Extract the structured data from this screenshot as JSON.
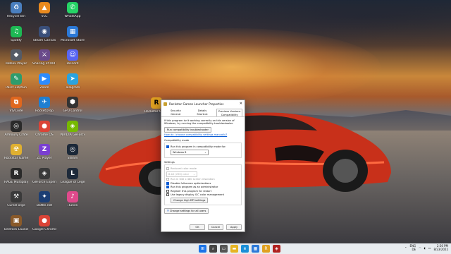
{
  "desktop_icons": [
    {
      "label": "Recycle Bin",
      "glyph": "♻",
      "color": "#4a7fbf"
    },
    {
      "label": "VLC",
      "glyph": "▲",
      "color": "#e98a1e"
    },
    {
      "label": "WhatsApp",
      "glyph": "✆",
      "color": "#25d366"
    },
    {
      "label": "Spotify",
      "glyph": "♫",
      "color": "#1db954"
    },
    {
      "label": "Steam Canvas",
      "glyph": "◉",
      "color": "#3a4f7a"
    },
    {
      "label": "Microsoft Store",
      "glyph": "▦",
      "color": "#2b79d8"
    },
    {
      "label": "Roblox Player",
      "glyph": "◆",
      "color": "#555b66"
    },
    {
      "label": "Sharing of Old Classic",
      "glyph": "⚔",
      "color": "#6a4a8a"
    },
    {
      "label": "Discord",
      "glyph": "☺",
      "color": "#5865f2"
    },
    {
      "label": "Paint 3D/Pain",
      "glyph": "✎",
      "color": "#2d9c6c"
    },
    {
      "label": "Zoom",
      "glyph": "▶",
      "color": "#2d8cff"
    },
    {
      "label": "Telegram",
      "glyph": "➤",
      "color": "#2aa3df"
    },
    {
      "label": "VS/Code",
      "glyph": "⧉",
      "color": "#e0671e"
    },
    {
      "label": "RocketDrop",
      "glyph": "✈",
      "color": "#1f7fd1"
    },
    {
      "label": "GPU Control",
      "glyph": "⬢",
      "color": "#333"
    },
    {
      "label": "Armoury Crate",
      "glyph": "◎",
      "color": "#2a2a2a"
    },
    {
      "label": "Chrome OS",
      "glyph": "●",
      "color": "#db4437"
    },
    {
      "label": "NVIDIA GeForce",
      "glyph": "◈",
      "color": "#76b900"
    },
    {
      "label": "Rockstar Games",
      "glyph": "☢",
      "color": "#e0b030"
    },
    {
      "label": "Z1 Player",
      "glyph": "Z",
      "color": "#7a3fd1"
    },
    {
      "label": "Steam",
      "glyph": "◎",
      "color": "#1b2838"
    },
    {
      "label": "RAGE Multiplayer",
      "glyph": "R",
      "color": "#2a2a2a"
    },
    {
      "label": "GeForce Experience",
      "glyph": "◈",
      "color": "#3a3a3a"
    },
    {
      "label": "League of Legends",
      "glyph": "L",
      "color": "#1e2a3a"
    },
    {
      "label": "CurseForge",
      "glyph": "⚒",
      "color": "#3a3a3a"
    },
    {
      "label": "Battle.net",
      "glyph": "✦",
      "color": "#1c3e74"
    },
    {
      "label": "iTunes",
      "glyph": "♪",
      "color": "#e04a8c"
    },
    {
      "label": "Bedrock Launch",
      "glyph": "▣",
      "color": "#8a5a2a"
    },
    {
      "label": "Google Chrome",
      "glyph": "●",
      "color": "#db4437"
    }
  ],
  "shortcut_on_desktop": {
    "label": "Rockstar Games Launcher",
    "glyph": "R"
  },
  "dialog": {
    "title": "Rockstar Games Launcher Properties",
    "tabs": [
      "Security",
      "Details",
      "Previous Versions",
      "General",
      "Shortcut",
      "Compatibility"
    ],
    "intro": "If this program isn't working correctly on this version of Windows, try running the compatibility troubleshooter.",
    "troubleshooter_btn": "Run compatibility troubleshooter",
    "manual_link": "How do I choose compatibility settings manually?",
    "compat_mode_label": "Compatibility mode",
    "compat_mode_check": "Run this program in compatibility mode for:",
    "compat_mode_value": "Windows 8",
    "settings_label": "Settings",
    "reduced_color": "Reduced color mode",
    "color_value": "8-bit (256) color",
    "run_640": "Run in 640 x 480 screen resolution",
    "disable_fullscreen": "Disable fullscreen optimizations",
    "run_admin": "Run this program as an administrator",
    "register_restart": "Register this program for restart",
    "legacy_icc": "Use legacy display ICC color management",
    "high_dpi_btn": "Change high DPI settings",
    "all_users_btn": "Change settings for all users",
    "ok": "OK",
    "cancel": "Cancel",
    "apply": "Apply"
  },
  "taskbar": {
    "apps": [
      {
        "name": "windows-start",
        "glyph": "⊞",
        "color": "#1a73e8"
      },
      {
        "name": "search",
        "glyph": "⌕",
        "color": "#444"
      },
      {
        "name": "task-view",
        "glyph": "▭",
        "color": "#555"
      },
      {
        "name": "file-explorer",
        "glyph": "▬",
        "color": "#e6b422"
      },
      {
        "name": "edge",
        "glyph": "e",
        "color": "#1a8fd8"
      },
      {
        "name": "store",
        "glyph": "▦",
        "color": "#2b79d8"
      },
      {
        "name": "rockstar",
        "glyph": "R",
        "color": "#e0a020"
      },
      {
        "name": "game",
        "glyph": "◈",
        "color": "#b02020"
      }
    ],
    "lang_top": "ENG",
    "lang_bottom": "DE",
    "time": "2:56 PM",
    "date": "8/23/2022"
  }
}
